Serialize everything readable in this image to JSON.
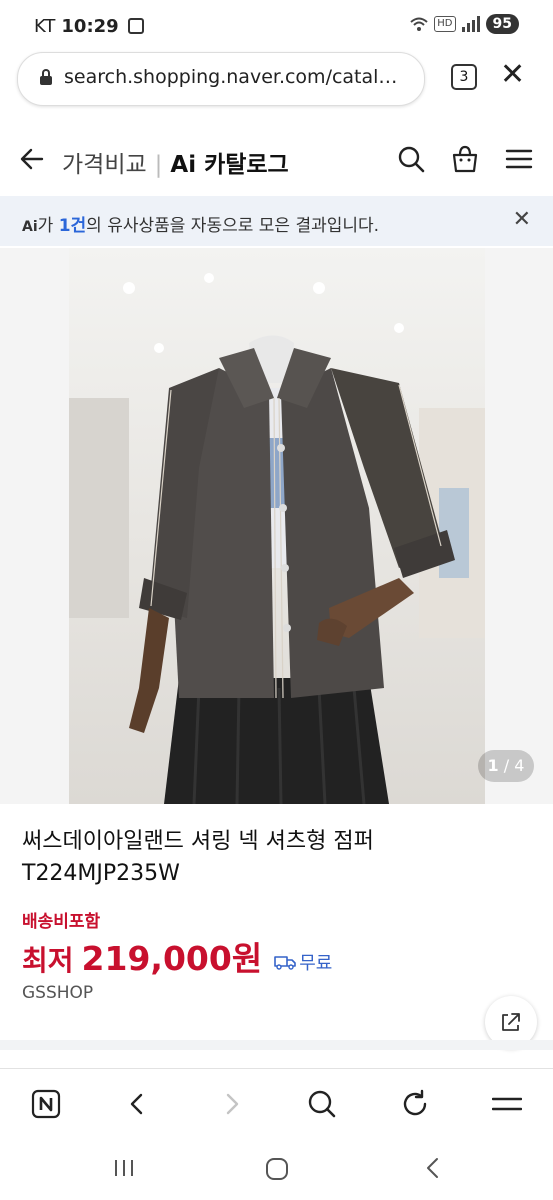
{
  "status_bar": {
    "carrier": "KT",
    "time": "10:29",
    "hd_label": "HD",
    "battery": "95"
  },
  "browser": {
    "url": "search.shopping.naver.com/catal…",
    "tab_count": "3"
  },
  "header": {
    "section": "가격비교",
    "brand": "Ai 카탈로그"
  },
  "notice": {
    "ai_label": "Ai",
    "prefix": "가 ",
    "count": "1건",
    "suffix": "의 유사상품을 자동으로 모은 결과입니다."
  },
  "gallery": {
    "current": "1",
    "separator": " / ",
    "total": "4"
  },
  "product": {
    "title": "써스데이아일랜드 셔링 넥 셔츠형 점퍼 T224MJP235W",
    "shipping_note": "배송비포함",
    "price_label": "최저",
    "price": "219,000원",
    "delivery": "무료",
    "seller": "GSSHOP"
  },
  "icons": {
    "back": "arrow-left-icon",
    "search": "search-icon",
    "cart": "shopping-bag-icon",
    "menu": "hamburger-icon",
    "share": "share-icon",
    "truck": "truck-icon"
  },
  "colors": {
    "price_red": "#c8102e",
    "link_blue": "#2b66d9",
    "notice_bg": "#eef2f8"
  }
}
